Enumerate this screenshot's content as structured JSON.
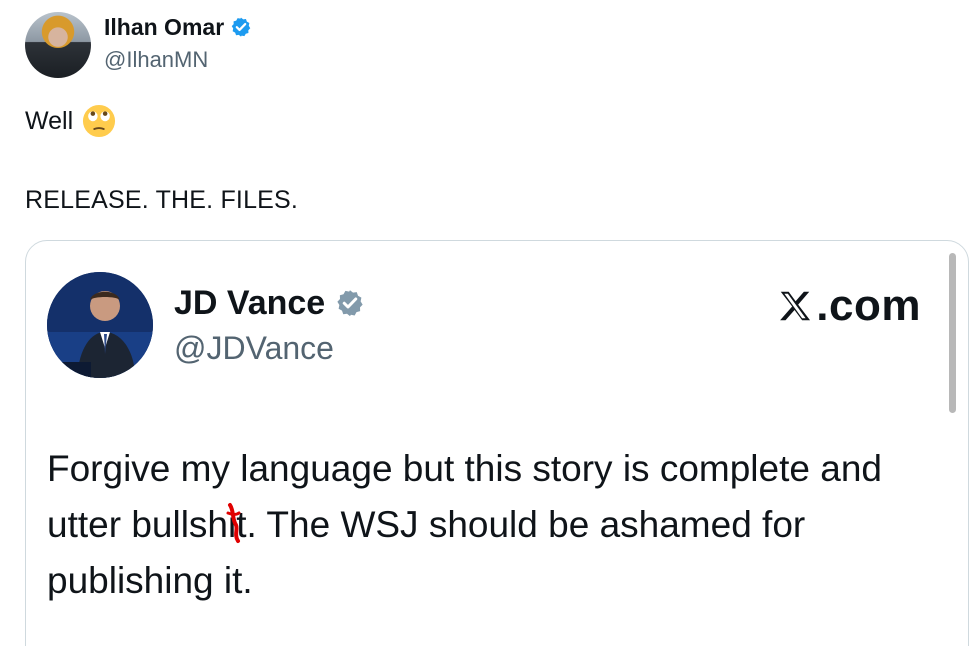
{
  "main_tweet": {
    "author_name": "Ilhan Omar",
    "author_handle": "@IlhanMN",
    "line1": "Well",
    "line1_emoji": "face-with-rolling-eyes",
    "line2": "RELEASE. THE. FILES.",
    "verified_color": "#1d9bf0"
  },
  "quoted_tweet": {
    "author_name": "JD Vance",
    "author_handle": "@JDVance",
    "source": ".com",
    "body_part1": "Forgive my language but this story is complete and utter bullsh",
    "body_redacted": "i",
    "body_part2": "t. The WSJ should be ashamed for publishing it.",
    "verified_color": "#829aab"
  },
  "colors": {
    "text": "#0f1419",
    "secondary_text": "#536471",
    "border": "#cfd9de",
    "annotation_red": "#e00000"
  }
}
